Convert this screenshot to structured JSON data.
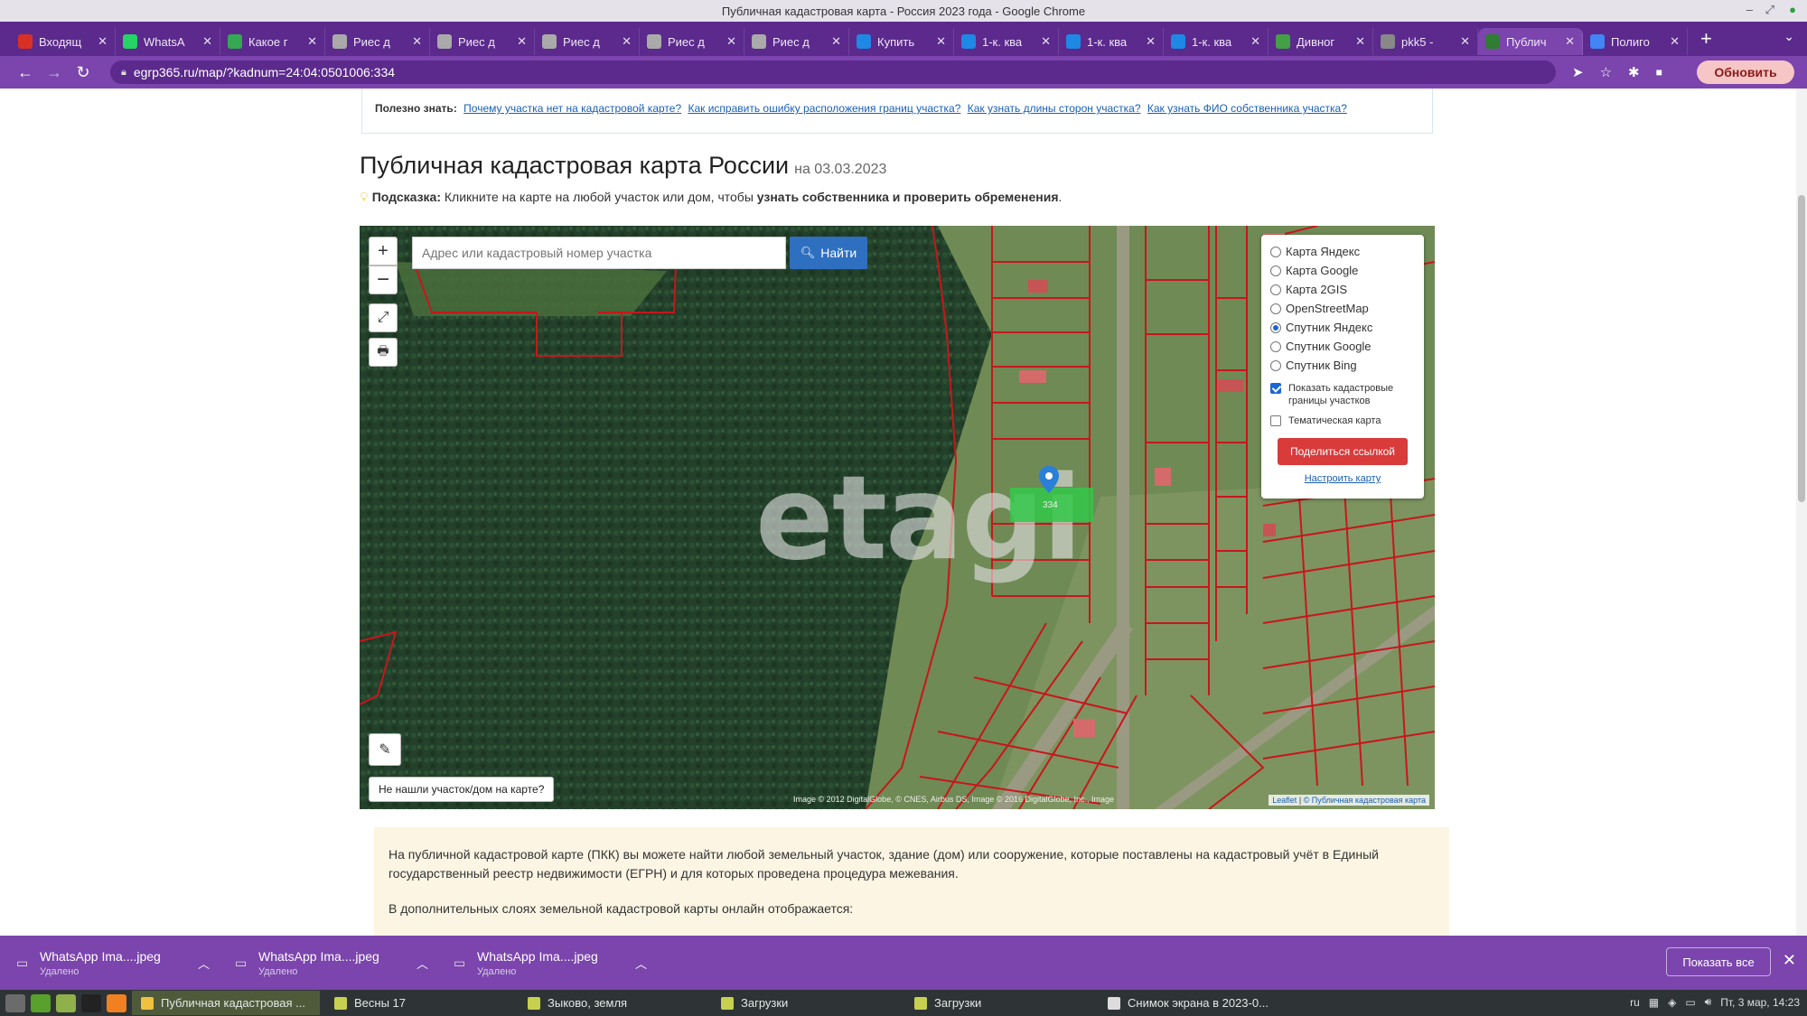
{
  "window": {
    "title": "Публичная кадастровая карта - Россия 2023 года - Google Chrome"
  },
  "tabs": [
    {
      "label": "Входящ",
      "color": "#d93025"
    },
    {
      "label": "WhatsA",
      "color": "#25d366"
    },
    {
      "label": "Какое г",
      "color": "#34a853"
    },
    {
      "label": "Риес д",
      "color": "#aaaaaa"
    },
    {
      "label": "Риес д",
      "color": "#aaaaaa"
    },
    {
      "label": "Риес д",
      "color": "#aaaaaa"
    },
    {
      "label": "Риес д",
      "color": "#aaaaaa"
    },
    {
      "label": "Риес д",
      "color": "#aaaaaa"
    },
    {
      "label": "Купить",
      "color": "#1e88e5"
    },
    {
      "label": "1-к. ква",
      "color": "#1e88e5"
    },
    {
      "label": "1-к. ква",
      "color": "#1e88e5"
    },
    {
      "label": "1-к. ква",
      "color": "#1e88e5"
    },
    {
      "label": "Дивног",
      "color": "#43a047"
    },
    {
      "label": "pkk5 -",
      "color": "#888888"
    },
    {
      "label": "Публич",
      "color": "#2e7d32",
      "active": true
    },
    {
      "label": "Полиго",
      "color": "#4285f4"
    }
  ],
  "toolbar": {
    "url": "egrp365.ru/map/?kadnum=24:04:0501006:334",
    "update_label": "Обновить"
  },
  "page": {
    "useful_label": "Полезно знать:",
    "useful_links": [
      "Почему участка нет на кадастровой карте?",
      "Как исправить ошибку расположения границ участка?",
      "Как узнать длины сторон участка?",
      "Как узнать ФИО собственника участка?"
    ],
    "title": "Публичная кадастровая карта России",
    "title_date": "на 03.03.2023",
    "tip_label": "Подсказка:",
    "tip_text": " Кликните на карте на любой участок или дом, чтобы ",
    "tip_bold": "узнать собственника и проверить обременения",
    "tip_end": "."
  },
  "map": {
    "search_placeholder": "Адрес или кадастровый номер участка",
    "search_button": "Найти",
    "not_found_button": "Не нашли участок/дом на карте?",
    "watermark": "etagi",
    "selected_parcel_label": "334",
    "layers": [
      {
        "label": "Карта Яндекс",
        "selected": false
      },
      {
        "label": "Карта Google",
        "selected": false
      },
      {
        "label": "Карта 2GIS",
        "selected": false
      },
      {
        "label": "OpenStreetMap",
        "selected": false
      },
      {
        "label": "Спутник Яндекс",
        "selected": true
      },
      {
        "label": "Спутник Google",
        "selected": false
      },
      {
        "label": "Спутник Bing",
        "selected": false
      }
    ],
    "show_borders_label": "Показать кадастровые границы участков",
    "show_borders_checked": true,
    "thematic_label": "Тематическая карта",
    "thematic_checked": false,
    "share_button": "Поделиться ссылкой",
    "configure_link": "Настроить карту",
    "attribution": "Image © 2012 DigitalGlobe, © CNES, Airbus DS, Image © 2016 DigitalGlobe, Inc., Image",
    "attribution_right_leaflet": "Leaflet",
    "attribution_right_pkk": "© Публичная кадастровая карта"
  },
  "info": {
    "paragraph1": "На публичной кадастровой карте (ПКК) вы можете найти любой земельный участок, здание (дом) или сооружение, которые поставлены на кадастровый учёт в Единый государственный реестр недвижимости (ЕГРН) и для которых проведена процедура межевания.",
    "paragraph2": "В дополнительных слоях земельной кадастровой карты онлайн отображается:"
  },
  "downloads": {
    "items": [
      {
        "name": "WhatsApp Ima....jpeg",
        "status": "Удалено"
      },
      {
        "name": "WhatsApp Ima....jpeg",
        "status": "Удалено"
      },
      {
        "name": "WhatsApp Ima....jpeg",
        "status": "Удалено"
      }
    ],
    "show_all": "Показать все"
  },
  "taskbar": {
    "tasks": [
      {
        "label": "Публичная кадастровая ...",
        "active": true
      },
      {
        "label": "Весны 17",
        "active": false
      },
      {
        "label": "Зыково, земля",
        "active": false
      },
      {
        "label": "Загрузки",
        "active": false
      },
      {
        "label": "Загрузки",
        "active": false
      },
      {
        "label": "Снимок экрана в 2023-0...",
        "active": false
      }
    ],
    "layout": "ru",
    "clock": "Пт, 3 мар, 14:23"
  }
}
